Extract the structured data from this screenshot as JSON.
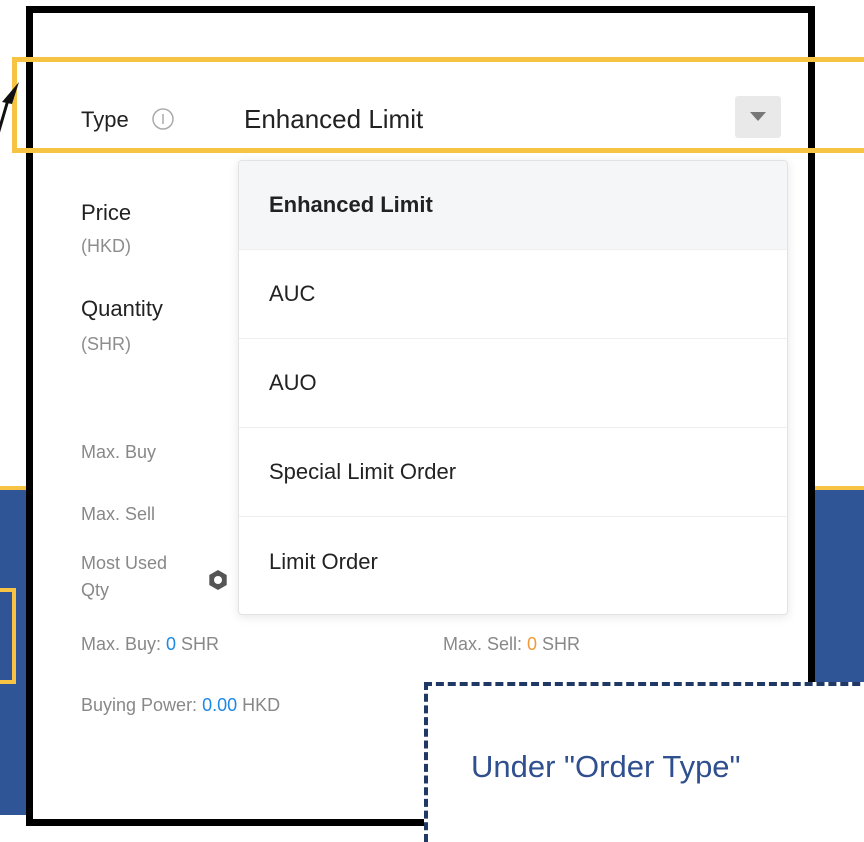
{
  "order_form": {
    "type_label": "Type",
    "type_value": "Enhanced Limit",
    "price_label": "Price",
    "price_unit": "(HKD)",
    "quantity_label": "Quantity",
    "quantity_unit": "(SHR)",
    "max_buy_label": "Max. Buy",
    "max_sell_label": "Max. Sell",
    "most_used_label": "Most Used",
    "most_used_label_line2": "Qty"
  },
  "order_type_dropdown": {
    "selected": "Enhanced Limit",
    "options": [
      "Enhanced Limit",
      "AUC",
      "AUO",
      "Special Limit Order",
      "Limit Order"
    ]
  },
  "summary": {
    "max_buy_prefix": "Max. Buy: ",
    "max_buy_value": "0",
    "max_buy_unit": " SHR",
    "max_sell_prefix": "Max. Sell: ",
    "max_sell_value": "0",
    "max_sell_unit": " SHR",
    "buying_power_prefix": "Buying Power: ",
    "buying_power_value": "0.00",
    "buying_power_unit": " HKD"
  },
  "callout": {
    "text": "Under \"Order Type\""
  },
  "colors": {
    "highlight": "#f6c342",
    "background_band": "#2f5597",
    "link_blue": "#1e88e5",
    "orange": "#f29a38"
  },
  "icons": [
    "info-icon",
    "chevron-down-icon",
    "settings-icon",
    "arrow-icon"
  ]
}
